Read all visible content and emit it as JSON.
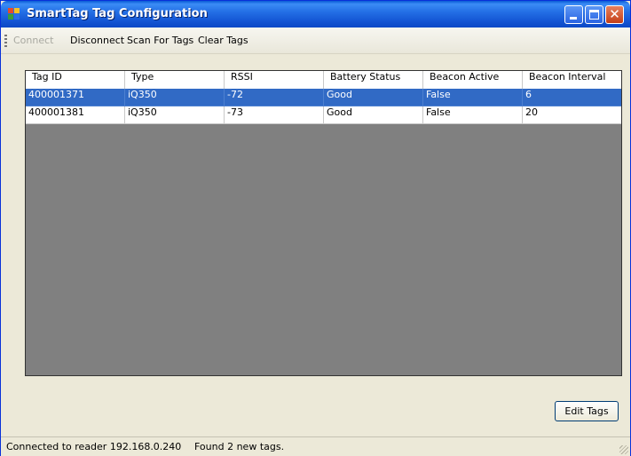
{
  "window": {
    "title": "SmartTag Tag Configuration"
  },
  "menu": {
    "items": [
      {
        "label": "Connect",
        "enabled": false
      },
      {
        "label": "Disconnect",
        "enabled": true
      },
      {
        "label": "Scan For Tags",
        "enabled": true
      },
      {
        "label": "Clear Tags",
        "enabled": true
      }
    ]
  },
  "grid": {
    "columns": [
      "Tag ID",
      "Type",
      "RSSI",
      "Battery Status",
      "Beacon Active",
      "Beacon Interval"
    ],
    "rows": [
      {
        "cells": [
          "400001371",
          "iQ350",
          "-72",
          "Good",
          "False",
          "6"
        ],
        "selected": true
      },
      {
        "cells": [
          "400001381",
          "iQ350",
          "-73",
          "Good",
          "False",
          "20"
        ],
        "selected": false
      }
    ]
  },
  "buttons": {
    "edit_tags": "Edit Tags"
  },
  "status": {
    "connection": "Connected to reader 192.168.0.240",
    "message": "Found 2 new tags."
  },
  "colors": {
    "selection": "#316ac5",
    "grid_background": "#808080",
    "title_bar": "#2470e6",
    "close_button": "#c43f17"
  },
  "icons": {
    "app": "app-window-icon",
    "minimize": "minimize-icon",
    "maximize": "maximize-icon",
    "close": "close-icon"
  }
}
